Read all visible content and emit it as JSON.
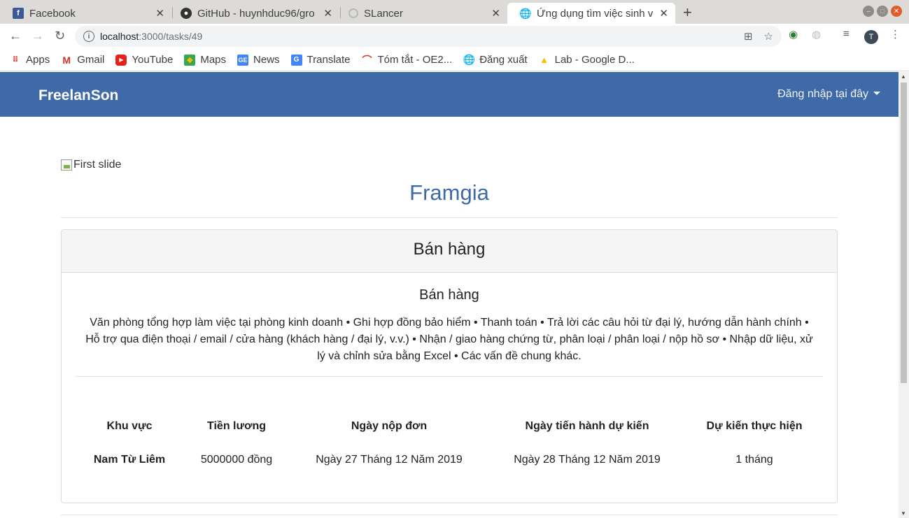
{
  "browser": {
    "tabs": [
      {
        "title": "Facebook",
        "icon": "facebook-icon",
        "active": false
      },
      {
        "title": "GitHub - huynhduc96/gro",
        "icon": "github-icon",
        "active": false
      },
      {
        "title": "SLancer",
        "icon": "loading-icon",
        "active": false
      },
      {
        "title": "Ứng dụng tìm việc sinh v",
        "icon": "globe-icon",
        "active": true
      }
    ],
    "url_host": "localhost",
    "url_path": ":3000/tasks/49",
    "profile_initial": "T",
    "bookmarks": [
      {
        "label": "Apps",
        "icon": "apps-grid-icon"
      },
      {
        "label": "Gmail",
        "icon": "gmail-icon"
      },
      {
        "label": "YouTube",
        "icon": "youtube-icon"
      },
      {
        "label": "Maps",
        "icon": "maps-icon"
      },
      {
        "label": "News",
        "icon": "news-icon"
      },
      {
        "label": "Translate",
        "icon": "translate-icon"
      },
      {
        "label": "Tóm tắt - OE2...",
        "icon": "oe-icon"
      },
      {
        "label": "Đăng xuất",
        "icon": "globe-icon"
      },
      {
        "label": "Lab - Google D...",
        "icon": "drive-icon"
      }
    ]
  },
  "site": {
    "brand": "FreelanSon",
    "login_label": "Đăng nhập tại đây",
    "slide_alt": "First slide",
    "company": "Framgia",
    "card_header": "Bán hàng",
    "job_title": "Bán hàng",
    "job_description": "Văn phòng tổng hợp làm việc tại phòng kinh doanh  • Ghi hợp đồng bảo hiểm  • Thanh toán  • Trả lời các câu hỏi từ đại lý, hướng dẫn hành chính  • Hỗ trợ qua điện thoại / email / cửa hàng (khách hàng / đại lý, v.v.)  • Nhận / giao hàng chứng từ, phân loại / phân loại / nộp hồ sơ  • Nhập dữ liệu, xử lý và chỉnh sửa bằng Excel  • Các vấn đề chung khác.",
    "table": {
      "headers": [
        "Khu vực",
        "Tiền lương",
        "Ngày nộp đơn",
        "Ngày tiến hành dự kiến",
        "Dự kiến thực hiện"
      ],
      "row": [
        "Nam Từ Liêm",
        "5000000 đồng",
        "Ngày 27 Tháng 12 Năm 2019",
        "Ngày 28 Tháng 12 Năm 2019",
        "1 tháng"
      ]
    },
    "colors": {
      "navbar": "#3f6aa8",
      "company": "#3f6aa8"
    }
  }
}
